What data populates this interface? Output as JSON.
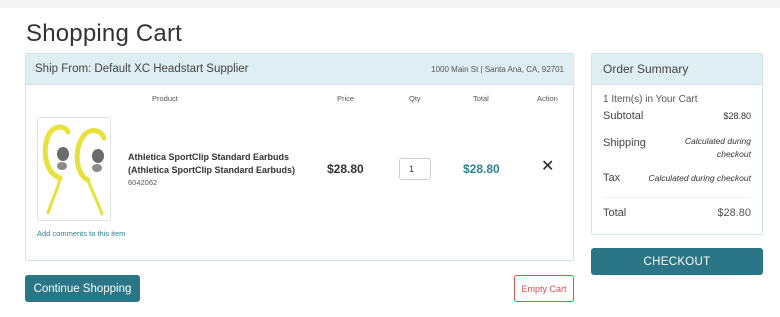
{
  "page": {
    "title": "Shopping Cart"
  },
  "cart": {
    "ship_from": "Ship From: Default XC Headstart Supplier",
    "ship_address": "1000 Main St | Santa Ana, CA, 92701",
    "columns": {
      "product": "Product",
      "price": "Price",
      "qty": "Qty",
      "total": "Total",
      "action": "Action"
    },
    "items": [
      {
        "name": "Athletica SportClip Standard Earbuds (Athletica SportClip Standard Earbuds)",
        "sku": "6042062",
        "price": "$28.80",
        "qty": "1",
        "total": "$28.80",
        "remove_icon": "close-icon",
        "image_icon": "earbuds-product-image"
      }
    ],
    "add_comments": "Add comments to this item"
  },
  "actions": {
    "continue_label": "Continue Shopping",
    "empty_label": "Empty Cart",
    "checkout_label": "CHECKOUT"
  },
  "summary": {
    "title": "Order Summary",
    "items_count": "1 Item(s) in Your Cart",
    "subtotal_label": "Subtotal",
    "subtotal_value": "$28.80",
    "shipping_label": "Shipping",
    "shipping_value": "Calculated during checkout",
    "tax_label": "Tax",
    "tax_value": "Calculated during checkout",
    "total_label": "Total",
    "total_value": "$28.80"
  },
  "colors": {
    "accent": "#2a7687",
    "link": "#2c8191",
    "panel_header": "#deeef2",
    "danger": "#d9534f",
    "product_yellow": "#e8e13a"
  }
}
